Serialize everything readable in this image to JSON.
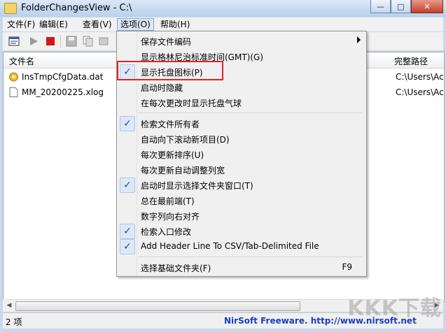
{
  "window": {
    "title": "FolderChangesView  -  C:\\",
    "buttons": {
      "minimize": "—",
      "maximize": "□",
      "close": "✕"
    }
  },
  "menubar": {
    "items": [
      {
        "label": "文件(F)"
      },
      {
        "label": "编辑(E)"
      },
      {
        "label": "查看(V)"
      },
      {
        "label": "选项(O)"
      },
      {
        "label": "帮助(H)"
      }
    ]
  },
  "toolbar": {
    "icons": [
      "properties-icon",
      "play-icon",
      "stop-icon",
      "save-icon",
      "copy-icon",
      "refresh-icon"
    ]
  },
  "list": {
    "columns": [
      "文件名",
      "完整路径"
    ],
    "rows": [
      {
        "name": "InsTmpCfgData.dat",
        "path": "C:\\Users\\Ac",
        "icon": "config-file-icon"
      },
      {
        "name": "MM_20200225.xlog",
        "path": "C:\\Users\\Ac",
        "icon": "document-icon"
      }
    ]
  },
  "options_menu": {
    "items": [
      {
        "label": "保存文件编码",
        "checked": false,
        "submenu": true
      },
      {
        "label": "显示格林尼治标准时间(GMT)(G)",
        "checked": false
      },
      {
        "label": "显示托盘图标(P)",
        "checked": true,
        "highlighted": true
      },
      {
        "label": "启动时隐藏",
        "checked": false
      },
      {
        "label": "在每次更改时显示托盘气球",
        "checked": false
      },
      {
        "label": "检索文件所有者",
        "checked": true
      },
      {
        "label": "自动向下滚动新项目(D)",
        "checked": false
      },
      {
        "label": "每次更新排序(U)",
        "checked": false
      },
      {
        "label": "每次更新自动调整列宽",
        "checked": false
      },
      {
        "label": "启动时显示选择文件夹窗口(T)",
        "checked": true
      },
      {
        "label": "总在最前端(T)",
        "checked": false
      },
      {
        "label": "数字列向右对齐",
        "checked": false
      },
      {
        "label": "检索入口修改",
        "checked": true
      },
      {
        "label": "Add Header Line To CSV/Tab-Delimited File",
        "checked": true
      },
      {
        "label": "选择基础文件夹(F)",
        "checked": false,
        "shortcut": "F9"
      }
    ]
  },
  "status": {
    "count": "2 项",
    "link": "NirSoft Freeware.  http://www.nirsoft.net"
  },
  "watermark": "KKK下载",
  "colors": {
    "highlight_border": "#e32227",
    "link": "#1a3fbf",
    "check_bg": "#dde8f6"
  }
}
